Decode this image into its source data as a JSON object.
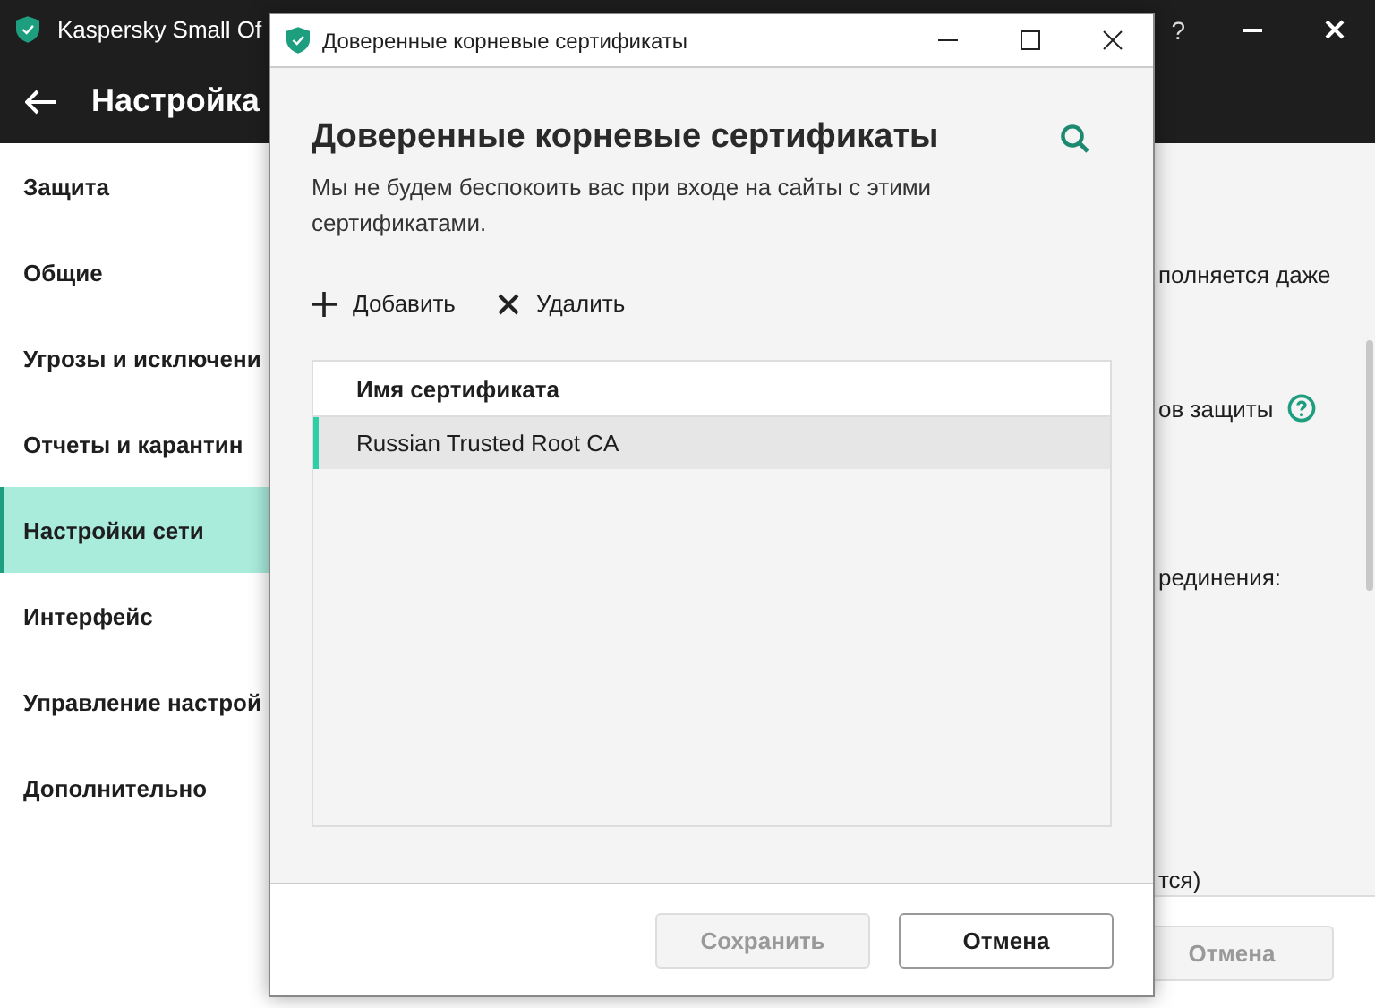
{
  "app_window": {
    "title": "Kaspersky Small Of",
    "help_button": "?",
    "header": "Настройка",
    "sidebar": {
      "items": [
        {
          "label": "Защита",
          "selected": false
        },
        {
          "label": "Общие",
          "selected": false
        },
        {
          "label": "Угрозы и исключени",
          "selected": false
        },
        {
          "label": "Отчеты и карантин",
          "selected": false
        },
        {
          "label": "Настройки сети",
          "selected": true
        },
        {
          "label": "Интерфейс",
          "selected": false
        },
        {
          "label": "Управление настрой",
          "selected": false
        },
        {
          "label": "Дополнительно",
          "selected": false
        }
      ]
    },
    "content": {
      "texts": [
        {
          "text": "полняется даже",
          "help": false
        },
        {
          "text": "ов защиты",
          "help": true
        },
        {
          "text": "рединения:",
          "help": false
        },
        {
          "text": "тся)",
          "help": false
        }
      ]
    },
    "footer": {
      "buttons": [
        {
          "label": "Отмена",
          "disabled": true
        }
      ]
    }
  },
  "dialog": {
    "title": "Доверенные корневые сертификаты",
    "heading": "Доверенные корневые сертификаты",
    "description": "Мы не будем беспокоить вас при входе на сайты с этими сертификатами.",
    "toolbar": [
      {
        "label": "Добавить",
        "kind": "add"
      },
      {
        "label": "Удалить",
        "kind": "remove"
      }
    ],
    "table": {
      "columns": [
        "Имя сертификата"
      ],
      "rows": [
        {
          "cells": [
            "Russian Trusted Root CA"
          ],
          "selected": true
        }
      ]
    },
    "buttons": [
      {
        "label": "Сохранить",
        "disabled": true
      },
      {
        "label": "Отмена",
        "disabled": false
      }
    ]
  }
}
